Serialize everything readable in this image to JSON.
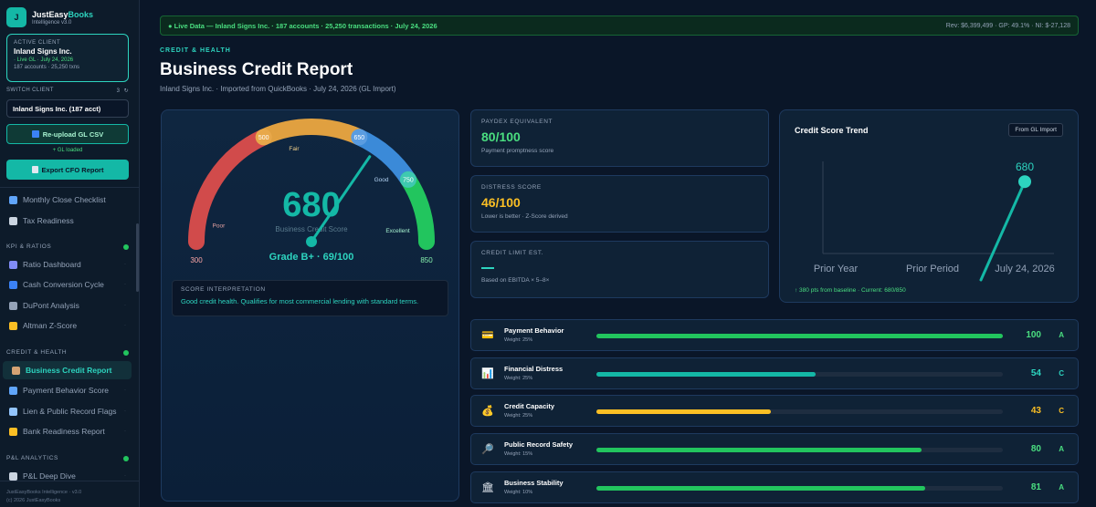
{
  "brand": {
    "name_a": "JustEasy",
    "name_b": "Books",
    "sub": "Intelligence v3.0",
    "logo": "J"
  },
  "active_client": {
    "label": "ACTIVE CLIENT",
    "name": "Inland Signs Inc.",
    "status": "· Live GL · July 24, 2026",
    "meta": "187 accounts · 25,250 txns"
  },
  "switch_client": {
    "label": "SWITCH CLIENT",
    "count": "3",
    "refresh_icon": "refresh-icon",
    "value": "Inland Signs Inc. (187 acct)"
  },
  "reupload": {
    "label": "Re-upload GL CSV",
    "icon": "upload-icon"
  },
  "gl_loaded": "+ GL loaded",
  "export": {
    "label": "Export CFO Report",
    "icon": "document-icon"
  },
  "nav": {
    "top": [
      {
        "label": "Monthly Close Checklist",
        "icon": "calendar-icon"
      },
      {
        "label": "Tax Readiness",
        "icon": "document-icon"
      }
    ],
    "kpi_section": "KPI & RATIOS",
    "kpi": [
      {
        "label": "Ratio Dashboard",
        "icon": "bar-chart-icon"
      },
      {
        "label": "Cash Conversion Cycle",
        "icon": "cycle-icon"
      },
      {
        "label": "DuPont Analysis",
        "icon": "microscope-icon"
      },
      {
        "label": "Altman Z-Score",
        "icon": "warning-icon"
      }
    ],
    "credit_section": "CREDIT & HEALTH",
    "credit": [
      {
        "label": "Business Credit Report",
        "icon": "bank-icon"
      },
      {
        "label": "Payment Behavior Score",
        "icon": "card-icon"
      },
      {
        "label": "Lien & Public Record Flags",
        "icon": "search-icon"
      },
      {
        "label": "Bank Readiness Report",
        "icon": "handshake-icon"
      }
    ],
    "pl_section": "P&L ANALYTICS",
    "pl": [
      {
        "label": "P&L Deep Dive",
        "icon": "chart-icon"
      }
    ],
    "dot": "·"
  },
  "footer": {
    "line1": "JustEasyBooks Intelligence · v3.0",
    "line2": "(c) 2026 JustEasyBooks"
  },
  "live_banner": {
    "left": "● Live Data — Inland Signs Inc. · 187 accounts · 25,250 transactions · July 24, 2026",
    "right": "Rev: $6,399,499 · GP: 49.1% · NI: $-27,128"
  },
  "header": {
    "section": "CREDIT & HEALTH",
    "title": "Business Credit Report",
    "subtitle": "Inland Signs Inc. · Imported from QuickBooks · July 24, 2026 (GL Import)"
  },
  "gauge": {
    "score": 680,
    "score_text": "680",
    "min": 300,
    "max": 850,
    "min_label": "300",
    "max_label": "850",
    "caption": "Business Credit Score",
    "grade": "Grade B+ · 69/100",
    "bands": [
      {
        "label": "Poor"
      },
      {
        "label": "Fair"
      },
      {
        "label": "Good"
      },
      {
        "label": "Excellent"
      }
    ],
    "ticks": [
      "500",
      "650",
      "750"
    ],
    "colors": {
      "poor": "#d14b4b",
      "fair": "#e0a040",
      "good": "#3b8ad8",
      "excellent": "#22c55e",
      "needle": "#14b8a6"
    }
  },
  "interpretation": {
    "label": "SCORE INTERPRETATION",
    "text": "Good credit health. Qualifies for most commercial lending with standard terms."
  },
  "metrics": [
    {
      "label": "PAYDEX EQUIVALENT",
      "value": "80/100",
      "sub": "Payment promptness score",
      "color": "#4ade80"
    },
    {
      "label": "DISTRESS SCORE",
      "value": "46/100",
      "sub": "Lower is better · Z-Score derived",
      "color": "#fbbf24"
    },
    {
      "label": "CREDIT LIMIT EST.",
      "value": "",
      "sub": "Based on EBITDA × 5–8×",
      "color": "#2dd4bf"
    }
  ],
  "trend": {
    "title": "Credit Score Trend",
    "badge": "From GL Import",
    "footer": "↑ 380 pts from baseline · Current: 680/850",
    "chart_data": {
      "type": "line",
      "categories": [
        "Prior Year",
        "Prior Period",
        "July 24, 2026"
      ],
      "series": [
        {
          "values": [
            null,
            300,
            680
          ]
        }
      ],
      "point_label": "680",
      "ylim": [
        300,
        850
      ],
      "color": "#14b8a6"
    }
  },
  "factors": [
    {
      "name": "Payment Behavior",
      "weight": "Weight: 25%",
      "score": 100,
      "score_text": "100",
      "grade": "A",
      "color": "#22c55e",
      "score_color": "#4ade80",
      "icon": "card-icon",
      "glyph": "💳"
    },
    {
      "name": "Financial Distress",
      "weight": "Weight: 25%",
      "score": 54,
      "score_text": "54",
      "grade": "C",
      "color": "#14b8a6",
      "score_color": "#2dd4bf",
      "icon": "bar-chart-icon",
      "glyph": "📊"
    },
    {
      "name": "Credit Capacity",
      "weight": "Weight: 25%",
      "score": 43,
      "score_text": "43",
      "grade": "C",
      "color": "#fbbf24",
      "score_color": "#fbbf24",
      "icon": "money-bag-icon",
      "glyph": "💰"
    },
    {
      "name": "Public Record Safety",
      "weight": "Weight: 15%",
      "score": 80,
      "score_text": "80",
      "grade": "A",
      "color": "#22c55e",
      "score_color": "#4ade80",
      "icon": "search-icon",
      "glyph": "🔎"
    },
    {
      "name": "Business Stability",
      "weight": "Weight: 10%",
      "score": 81,
      "score_text": "81",
      "grade": "A",
      "color": "#22c55e",
      "score_color": "#4ade80",
      "icon": "bank-icon",
      "glyph": "🏛"
    }
  ]
}
